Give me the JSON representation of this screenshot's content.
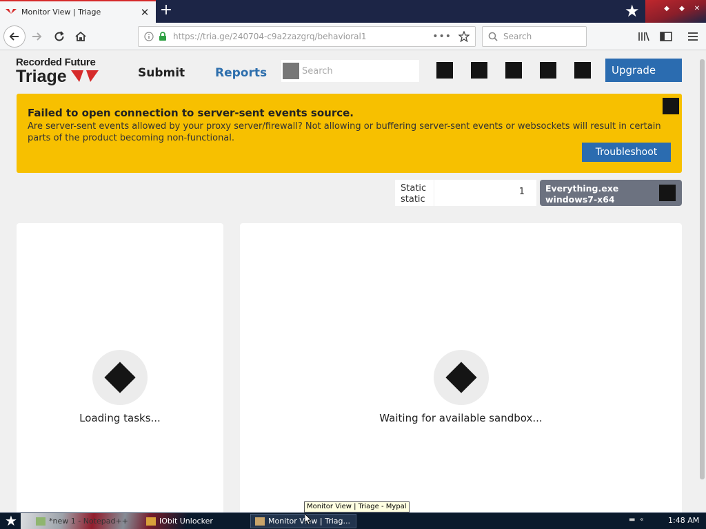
{
  "browser": {
    "tab_title": "Monitor View | Triage",
    "url": "https://tria.ge/240704-c9a2zazgrq/behavioral1",
    "search_placeholder": "Search"
  },
  "site": {
    "logo_top": "Recorded Future",
    "logo_bottom": "Triage",
    "nav": {
      "submit": "Submit",
      "reports": "Reports"
    },
    "search_placeholder": "Search",
    "upgrade_label": "Upgrade"
  },
  "alert": {
    "title": "Failed to open connection to server-sent events source.",
    "body": "Are server-sent events allowed by your proxy server/firewall? Not allowing or buffering server-sent events or websockets will result in certain parts of the product becoming non-functional.",
    "button": "Troubleshoot"
  },
  "static_panel": {
    "line1": "Static",
    "line2": "static",
    "count": "1"
  },
  "sample": {
    "name": "Everything.exe",
    "platform": "windows7-x64"
  },
  "tasks_card": {
    "status": "Loading tasks..."
  },
  "sandbox_card": {
    "status": "Waiting for available sandbox..."
  },
  "tooltip": "Monitor View | Triage - Mypal",
  "taskbar": {
    "items": [
      {
        "label": "*new 1 - Notepad++"
      },
      {
        "label": "IObit Unlocker"
      },
      {
        "label": "Monitor View | Triag..."
      }
    ],
    "clock": "1:48 AM"
  },
  "colors": {
    "accent_blue": "#2b6cb0",
    "alert_yellow": "#f7c000",
    "reports_link": "#2e6fad",
    "sample_gray": "#6c7280"
  }
}
